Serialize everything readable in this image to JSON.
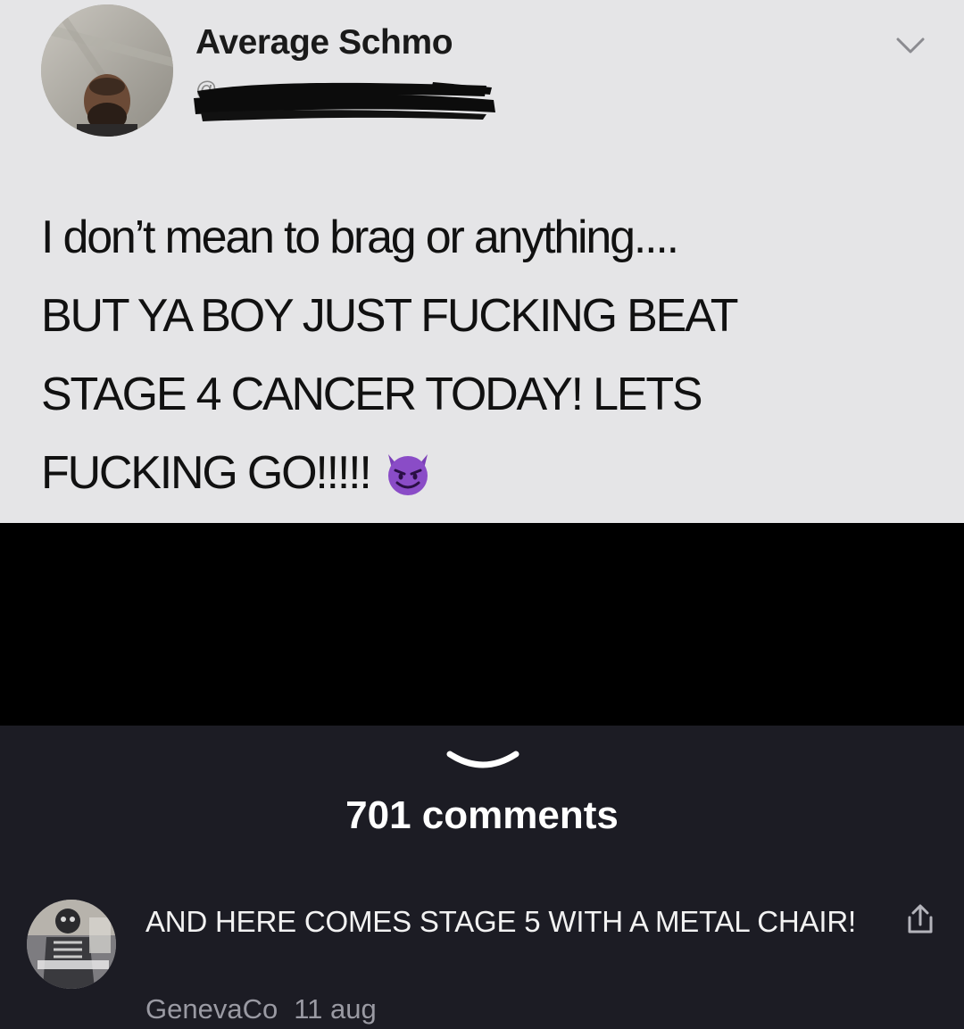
{
  "tweet": {
    "display_name": "Average Schmo",
    "handle": "",
    "lines": [
      "I don’t mean to brag or anything....",
      "BUT YA BOY JUST FUCKING BEAT",
      "STAGE 4 CANCER TODAY! LETS",
      "FUCKING GO!!!!!"
    ],
    "emoji": "smiling-devil-emoji",
    "icons": {
      "menu": "chevron-down-icon"
    }
  },
  "comments": {
    "count_label": "701 comments",
    "collapse_icon": "chevron-down-icon",
    "items": [
      {
        "text": "AND HERE COMES STAGE 5 WITH A METAL CHAIR!",
        "author": "GenevaCo",
        "date": "11 aug",
        "share_icon": "share-icon"
      }
    ]
  },
  "colors": {
    "tweet_background": "#e5e5e7",
    "black_band": "#000000",
    "comments_background": "#1c1c24",
    "comment_text": "#f2f2f2",
    "meta_text": "#9a9aa3",
    "emoji_purple": "#7b3fb8"
  }
}
